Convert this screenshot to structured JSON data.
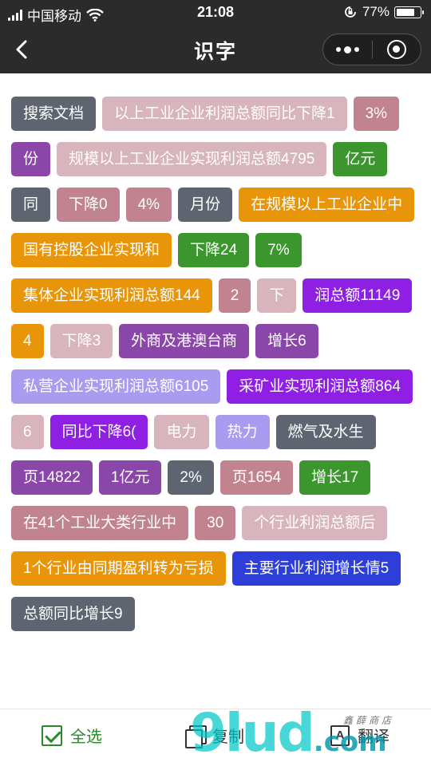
{
  "status_bar": {
    "carrier": "中国移动",
    "time": "21:08",
    "battery_percent_text": "77%",
    "battery_level": 0.77
  },
  "nav": {
    "title": "识字",
    "icons": [
      "back-icon",
      "more-dots-icon",
      "close-target-icon"
    ]
  },
  "tags": [
    {
      "text": "搜索文档",
      "color": "#5f6570"
    },
    {
      "text": "以上工业企业利润总额同比下降1",
      "color": "#d8b4bc"
    },
    {
      "text": "3%",
      "color": "#c0838f"
    },
    {
      "text": "份",
      "color": "#8a46a8"
    },
    {
      "text": "规模以上工业企业实现利润总额4795",
      "color": "#d8b4bc"
    },
    {
      "text": "亿元",
      "color": "#3c962e"
    },
    {
      "text": "同",
      "color": "#5f6570"
    },
    {
      "text": "下降0",
      "color": "#c0838f"
    },
    {
      "text": "4%",
      "color": "#c0838f"
    },
    {
      "text": "月份",
      "color": "#5f6570"
    },
    {
      "text": "在规模以上工业企业中",
      "color": "#e8950a"
    },
    {
      "text": "国有控股企业实现和",
      "color": "#e8950a"
    },
    {
      "text": "下降24",
      "color": "#3c962e"
    },
    {
      "text": "7%",
      "color": "#3c962e"
    },
    {
      "text": "集体企业实现利润总额144",
      "color": "#e8950a"
    },
    {
      "text": "2",
      "color": "#c0838f"
    },
    {
      "text": "下",
      "color": "#d8b4bc"
    },
    {
      "text": "润总额11149",
      "color": "#8e1fe3"
    },
    {
      "text": "4",
      "color": "#e8950a"
    },
    {
      "text": "下降3",
      "color": "#d8b4bc"
    },
    {
      "text": "外商及港澳台商",
      "color": "#8a46a8"
    },
    {
      "text": "增长6",
      "color": "#8a46a8"
    },
    {
      "text": "私营企业实现利润总额6105",
      "color": "#a99cf0"
    },
    {
      "text": "采矿业实现利润总额864",
      "color": "#8e1fe3"
    },
    {
      "text": "6",
      "color": "#d8b4bc"
    },
    {
      "text": "同比下降6(",
      "color": "#8e1fe3"
    },
    {
      "text": "电力",
      "color": "#d8b4bc"
    },
    {
      "text": "热力",
      "color": "#a99cf0"
    },
    {
      "text": "燃气及水生",
      "color": "#5f6570"
    },
    {
      "text": "页14822",
      "color": "#8a46a8"
    },
    {
      "text": "1亿元",
      "color": "#8a46a8"
    },
    {
      "text": "2%",
      "color": "#5f6570"
    },
    {
      "text": "页1654",
      "color": "#c0838f"
    },
    {
      "text": "增长17",
      "color": "#3c962e"
    },
    {
      "text": "在41个工业大类行业中",
      "color": "#c0838f"
    },
    {
      "text": "30",
      "color": "#c0838f"
    },
    {
      "text": "个行业利润总额后",
      "color": "#d8b4bc"
    },
    {
      "text": "1个行业由同期盈利转为亏损",
      "color": "#e8950a"
    },
    {
      "text": "主要行业利润增长情5",
      "color": "#2d3fd8"
    },
    {
      "text": "总额同比增长9",
      "color": "#5f6570"
    }
  ],
  "toolbar": {
    "select_all": "全选",
    "copy": "复制",
    "translate": "翻译",
    "translate_icon_glyph": "A",
    "accent": "#2a8a2a"
  },
  "watermark": {
    "main": "9lud",
    "suffix": ".com",
    "shop": "鑫薛商店"
  }
}
